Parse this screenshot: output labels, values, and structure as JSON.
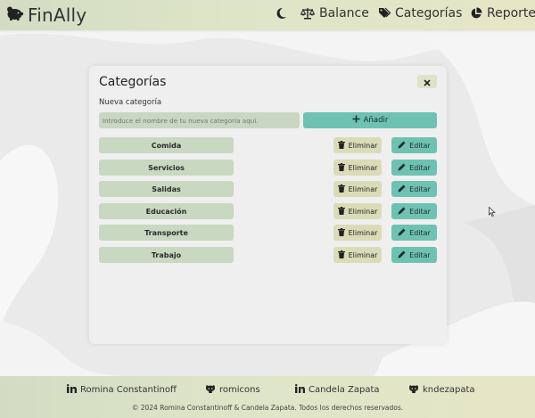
{
  "colors": {
    "accent": "#6ec2b2",
    "header": "#dfe5c8",
    "chip": "#c9d8c1",
    "delete": "#dadcb8"
  },
  "header": {
    "logo_text": "FinAlly",
    "logo_icon": "piggy-bank-icon",
    "theme_icon": "moon-icon",
    "nav": [
      {
        "label": "Balance",
        "icon": "scale-icon"
      },
      {
        "label": "Categorías",
        "icon": "tags-icon"
      },
      {
        "label": "Reporte",
        "icon": "pie-chart-icon"
      }
    ]
  },
  "modal": {
    "title": "Categorías",
    "close_label": "×",
    "field_label": "Nueva categoría",
    "input_value": "",
    "input_placeholder": "Introduce el nombre de tu nueva categoría aquí.",
    "add_label": "Añadir",
    "delete_label": "Eliminar",
    "edit_label": "Editar",
    "categories": [
      "Comida",
      "Servicios",
      "Salidas",
      "Educación",
      "Transporte",
      "Trabajo"
    ]
  },
  "footer": {
    "links": [
      {
        "label": "Romina Constantinoff",
        "icon": "linkedin-icon"
      },
      {
        "label": "romicons",
        "icon": "github-icon"
      },
      {
        "label": "Candela Zapata",
        "icon": "linkedin-icon"
      },
      {
        "label": "kndezapata",
        "icon": "github-icon"
      }
    ],
    "copyright": "© 2024 Romina Constantinoff & Candela Zapata. Todos los derechos reservados."
  }
}
